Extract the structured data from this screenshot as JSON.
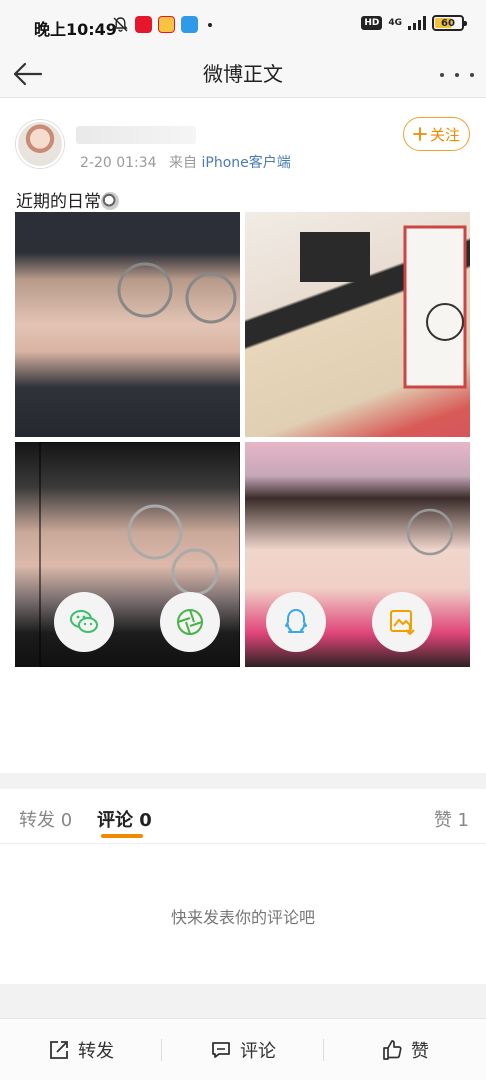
{
  "status_bar": {
    "time": "晚上10:49",
    "hd_label": "HD",
    "network": "4G",
    "battery": "60",
    "battery_level": 0.6
  },
  "nav": {
    "title": "微博正文"
  },
  "post": {
    "timestamp": "2-20 01:34",
    "source_prefix": "来自",
    "source": "iPhone客户端",
    "follow_label": "关注",
    "text": "近期的日常"
  },
  "share": {
    "items": [
      "wechat-icon",
      "moments-icon",
      "qq-icon",
      "save-image-icon"
    ]
  },
  "tabs": {
    "repost": "转发 0",
    "comment": "评论 0",
    "like": "赞 1"
  },
  "comments": {
    "empty_text": "快来发表你的评论吧"
  },
  "bottom_bar": {
    "repost": "转发",
    "comment": "评论",
    "like": "赞"
  },
  "colors": {
    "accent": "#f08a00",
    "link": "#4a7ab5",
    "wechat": "#3cbf6a",
    "qq": "#39a7ea",
    "save": "#f2a000"
  }
}
